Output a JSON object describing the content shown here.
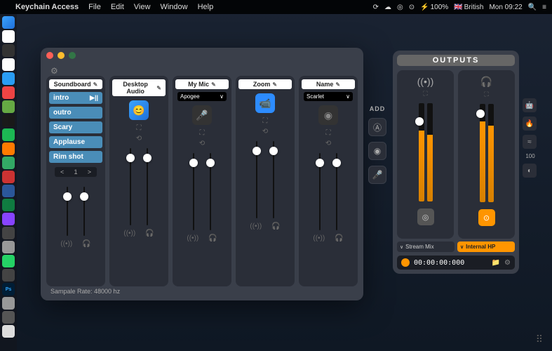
{
  "menubar": {
    "app": "Keychain Access",
    "items": [
      "File",
      "Edit",
      "View",
      "Window",
      "Help"
    ],
    "battery": "100%",
    "lang": "British",
    "time": "Mon 09:22"
  },
  "window": {
    "sample_rate": "Sampale Rate: 48000 hz"
  },
  "soundboard": {
    "header": "Soundboard",
    "items": [
      "intro",
      "outro",
      "Scary",
      "Applause",
      "Rim shot"
    ],
    "play_icon": "▶||",
    "page": "1"
  },
  "channels": [
    {
      "header": "Desktop Audio",
      "select": null,
      "icon": "finder"
    },
    {
      "header": "My Mic",
      "select": "Apogee",
      "icon": "mic"
    },
    {
      "header": "Zoom",
      "select": null,
      "icon": "zoom"
    },
    {
      "header": "Name",
      "select": "Scarlet",
      "icon": "rec"
    }
  ],
  "add": {
    "label": "ADD"
  },
  "outputs": {
    "title": "OUTPUTS",
    "dropdowns": [
      {
        "label": "Stream Mix",
        "style": "gray"
      },
      {
        "label": "Internal HP",
        "style": "orange"
      }
    ],
    "rec_time": "00:00:00:000"
  },
  "dest_num": "100"
}
